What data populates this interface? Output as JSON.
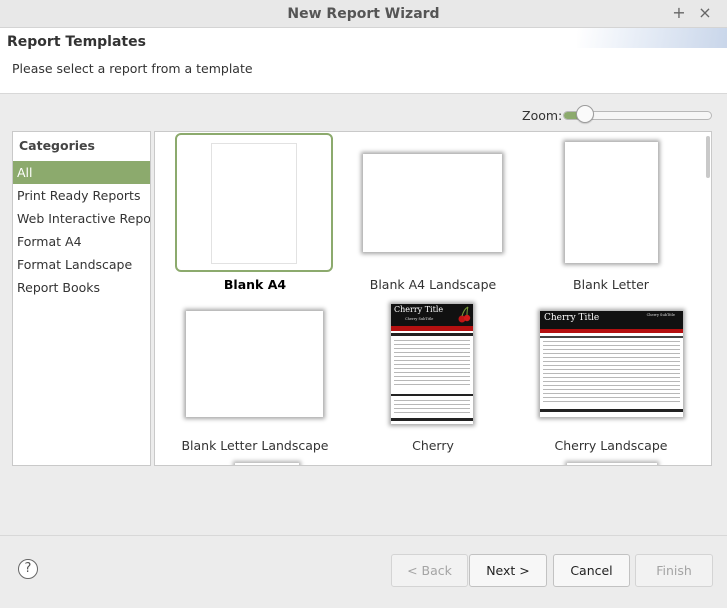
{
  "window": {
    "title": "New Report Wizard",
    "controls": {
      "maximize": "+",
      "close": "×"
    }
  },
  "header": {
    "title": "Report Templates",
    "description": "Please select a report from a template"
  },
  "zoom": {
    "label": "Zoom:",
    "level": 0.1
  },
  "categories": {
    "heading": "Categories",
    "items": [
      {
        "label": "All",
        "selected": true
      },
      {
        "label": "Print Ready Reports",
        "selected": false
      },
      {
        "label": "Web Interactive Reports",
        "selected": false
      },
      {
        "label": "Format A4",
        "selected": false
      },
      {
        "label": "Format Landscape",
        "selected": false
      },
      {
        "label": "Report Books",
        "selected": false
      }
    ]
  },
  "templates": [
    {
      "label": "Blank A4",
      "selected": true
    },
    {
      "label": "Blank A4 Landscape",
      "selected": false
    },
    {
      "label": "Blank Letter",
      "selected": false
    },
    {
      "label": "Blank Letter Landscape",
      "selected": false
    },
    {
      "label": "Cherry",
      "selected": false
    },
    {
      "label": "Cherry Landscape",
      "selected": false
    }
  ],
  "thumbnail_text": {
    "cherry_title": "Cherry Title",
    "cherry_subtitle": "Cherry SubTitle"
  },
  "buttons": {
    "back": "< Back",
    "next": "Next >",
    "cancel": "Cancel",
    "finish": "Finish",
    "help": "?"
  },
  "colors": {
    "accent_green": "#8caa6d",
    "cherry_red": "#b51010"
  }
}
